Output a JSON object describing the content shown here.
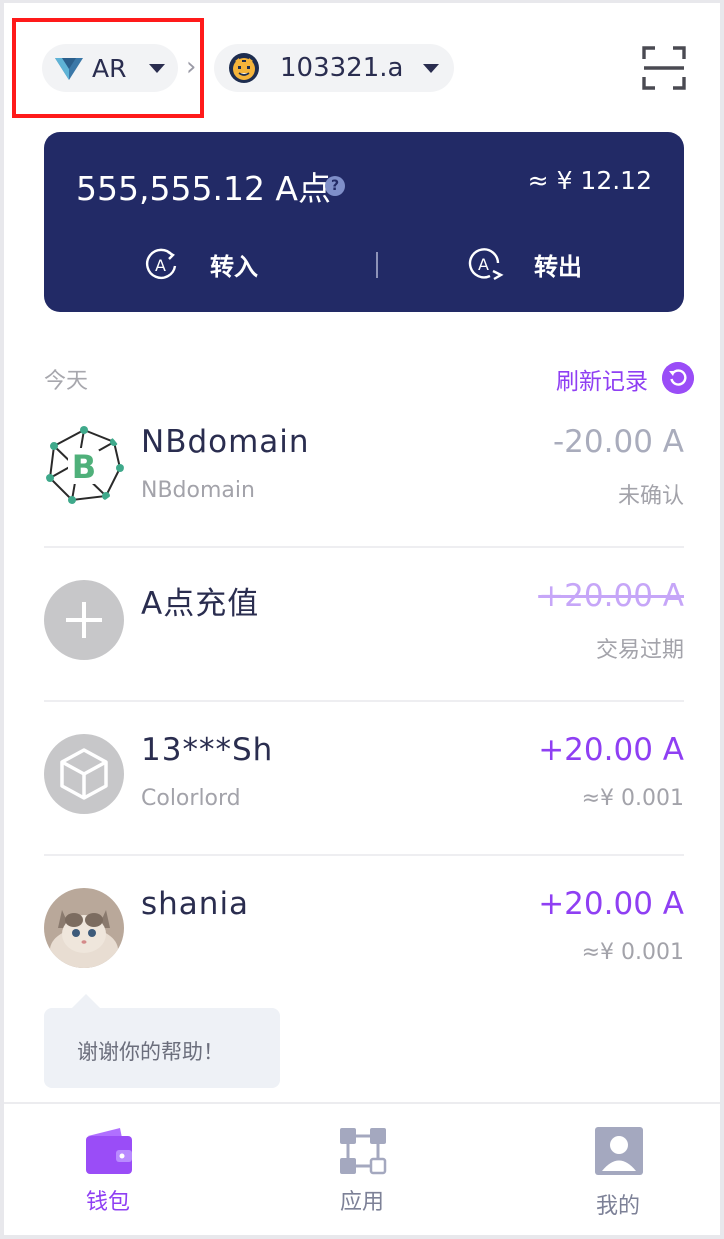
{
  "header": {
    "network": {
      "label": "AR",
      "icon": "ar-diamond-icon"
    },
    "account": {
      "label": "103321.a",
      "icon": "tiger-avatar-icon"
    },
    "separator": "›",
    "scan_icon": "scan-icon"
  },
  "balance_card": {
    "balance": "555,555.12 A点",
    "help_mark": "?",
    "fiat": "≈ ¥ 12.12",
    "transfer_in_label": "转入",
    "transfer_out_label": "转出",
    "background": "#222a66"
  },
  "records": {
    "date_label": "今天",
    "refresh_label": "刷新记录",
    "items": [
      {
        "name": "NBdomain",
        "sub": "NBdomain",
        "amount": "-20.00 A",
        "status": "未确认",
        "avatar": "nbdomain-logo"
      },
      {
        "name": "A点充值",
        "sub": "",
        "amount": "+20.00 A",
        "status": "交易过期",
        "avatar": "plus-icon"
      },
      {
        "name": "13***Sh",
        "sub": "Colorlord",
        "amount": "+20.00 A",
        "status": "≈¥ 0.001",
        "avatar": "cube-icon"
      },
      {
        "name": "shania",
        "sub": "",
        "amount": "+20.00 A",
        "status": "≈¥ 0.001",
        "avatar": "kitten-photo"
      }
    ]
  },
  "message": {
    "text": "谢谢你的帮助！"
  },
  "bottom_nav": {
    "items": [
      {
        "label": "钱包",
        "icon": "wallet-icon",
        "active": true
      },
      {
        "label": "应用",
        "icon": "apps-icon",
        "active": false
      },
      {
        "label": "我的",
        "icon": "profile-icon",
        "active": false
      }
    ]
  },
  "colors": {
    "accent": "#8f3ff3",
    "card": "#222a66",
    "highlight": "#ff1a1a"
  }
}
